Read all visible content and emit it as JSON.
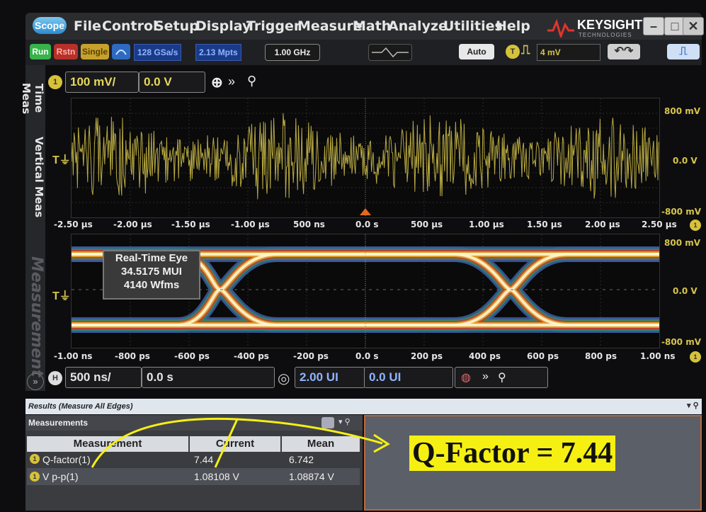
{
  "menubar": {
    "scope_label": "Scope",
    "items": [
      "File",
      "Control",
      "Setup",
      "Display",
      "Trigger",
      "Measure",
      "Math",
      "Analyze",
      "Utilities",
      "Help"
    ],
    "brand": "KEYSIGHT",
    "brand_sub": "TECHNOLOGIES"
  },
  "toolbar": {
    "run": "Run",
    "rstop": "Rstn",
    "single": "Single",
    "sample_rate": "128 GSa/s",
    "memory": "2.13 Mpts",
    "bandwidth": "1.00 GHz",
    "auto": "Auto",
    "trigger_level": "4 mV"
  },
  "sidetabs": [
    "Time Meas",
    "Vertical Meas",
    "Measurement"
  ],
  "channel": {
    "number": "1",
    "scale": "100 mV/",
    "offset": "0.0 V"
  },
  "plot_top": {
    "y_labels": [
      "800 mV",
      "0.0 V",
      "-800 mV"
    ],
    "x_labels": [
      "-2.50 µs",
      "-2.00 µs",
      "-1.50 µs",
      "-1.00 µs",
      "500 ns",
      "0.0 s",
      "500 µs",
      "1.00 µs",
      "1.50 µs",
      "2.00 µs",
      "2.50 µs"
    ]
  },
  "plot_eye": {
    "y_labels": [
      "800 mV",
      "0.0 V",
      "-800 mV"
    ],
    "x_labels": [
      "-1.00 ns",
      "-800 ps",
      "-600 ps",
      "-400 ps",
      "-200 ps",
      "0.0 s",
      "200 ps",
      "400 ps",
      "600 ps",
      "800 ps",
      "1.00 ns"
    ],
    "info": [
      "Real-Time Eye",
      "34.5175 MUI",
      "4140 Wfms"
    ]
  },
  "horizontal": {
    "badge": "H",
    "scale": "500 ns/",
    "position": "0.0 s",
    "ui_scale": "2.00 UI",
    "ui_pos": "0.0 UI"
  },
  "results": {
    "bar_label": "Results  (Measure All Edges)",
    "panel_title": "Measurements",
    "headers": [
      "Measurement",
      "Current",
      "Mean"
    ],
    "rows": [
      {
        "badge": "1",
        "name": "Q-factor(1)",
        "current": "7.44",
        "mean": "6.742"
      },
      {
        "badge": "1",
        "name": "V p-p(1)",
        "current": "1.08108 V",
        "mean": "1.08874 V"
      }
    ]
  },
  "annotation": {
    "text": "Q-Factor = 7.44",
    "highlight": "#f5f012",
    "arrow_color": "#f5f012"
  },
  "colors": {
    "trace": "#d7c54a",
    "eye_core": "#fff5d0"
  }
}
